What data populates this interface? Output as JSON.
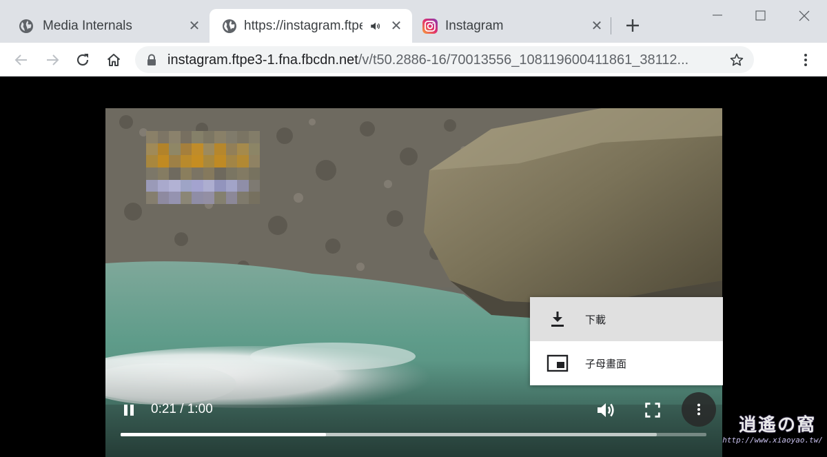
{
  "tabs": [
    {
      "title": "Media Internals",
      "favicon": "globe-icon",
      "active": false
    },
    {
      "title": "https://instagram.ftpe",
      "favicon": "globe-icon",
      "active": true,
      "audio": "speaker-icon"
    },
    {
      "title": "Instagram",
      "favicon": "instagram-icon",
      "active": false
    }
  ],
  "toolbar": {
    "url_host": "instagram.ftpe3-1.fna.fbcdn.net",
    "url_path": "/v/t50.2886-16/70013556_108119600411861_38112..."
  },
  "video": {
    "current_time": "0:21",
    "duration": "1:00",
    "time_separator": " / ",
    "progress_fraction": 0.35,
    "buffered_fraction": 0.915
  },
  "menu": {
    "items": [
      {
        "label": "下載",
        "icon": "download-icon"
      },
      {
        "label": "子母畫面",
        "icon": "picture-in-picture-icon"
      }
    ]
  },
  "watermark": {
    "logo_text": "逍遙の窩",
    "url": "http://www.xiaoyao.tw/"
  },
  "colors": {
    "tabstrip": "#dee1e6",
    "toolbar": "#ffffff",
    "omnibox": "#f1f3f4",
    "menu_hover": "#e0e0e0"
  }
}
